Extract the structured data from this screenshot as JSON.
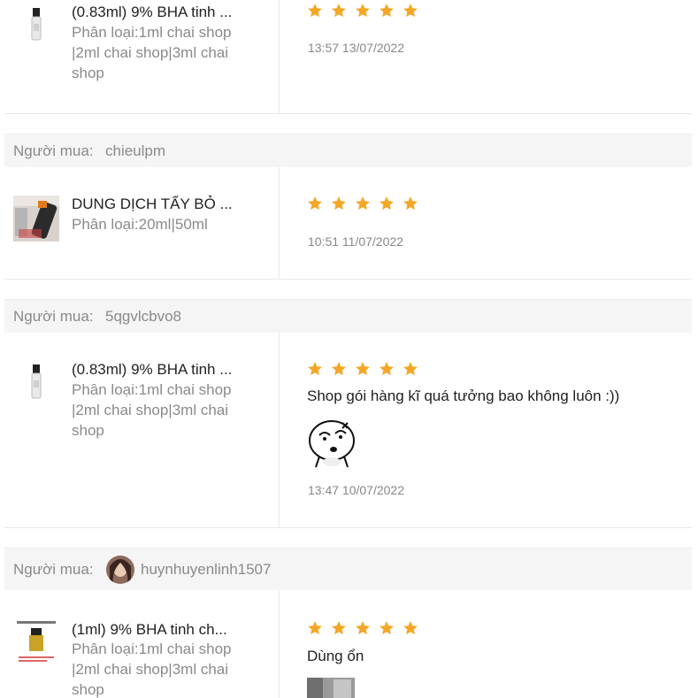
{
  "reviews": [
    {
      "product_title": "(0.83ml) 9% BHA tinh ...",
      "variation_lines": [
        "Phân loại:1ml chai shop",
        "|2ml chai shop|3ml chai",
        "shop"
      ],
      "rating": 5,
      "time": "13:57 13/07/2022"
    },
    {
      "buyer_label": "Người mua:",
      "buyer_name": "chieulpm",
      "product_title": "DUNG DỊCH TẨY BỎ ...",
      "variation_lines": [
        "Phân loại:20ml|50ml"
      ],
      "rating": 5,
      "time": "10:51 11/07/2022"
    },
    {
      "buyer_label": "Người mua:",
      "buyer_name": "5qgvlcbvo8",
      "product_title": "(0.83ml) 9% BHA tinh ...",
      "variation_lines": [
        "Phân loại:1ml chai shop",
        "|2ml chai shop|3ml chai",
        "shop"
      ],
      "rating": 5,
      "comment": "Shop gói hàng kĩ quá tưởng bao không luôn :))",
      "time": "13:47 10/07/2022"
    },
    {
      "buyer_label": "Người mua: ",
      "buyer_name": "huynhuyenlinh1507",
      "product_title": "(1ml) 9% BHA tinh ch...",
      "variation_lines": [
        "Phân loại:1ml chai shop",
        "|2ml chai shop|3ml chai",
        "shop"
      ],
      "rating": 5,
      "comment": "Dùng ổn"
    }
  ],
  "colors": {
    "star": "#f5a623",
    "muted": "#8a8a8a",
    "band": "#f5f5f5",
    "divider": "#e8e8e8"
  }
}
